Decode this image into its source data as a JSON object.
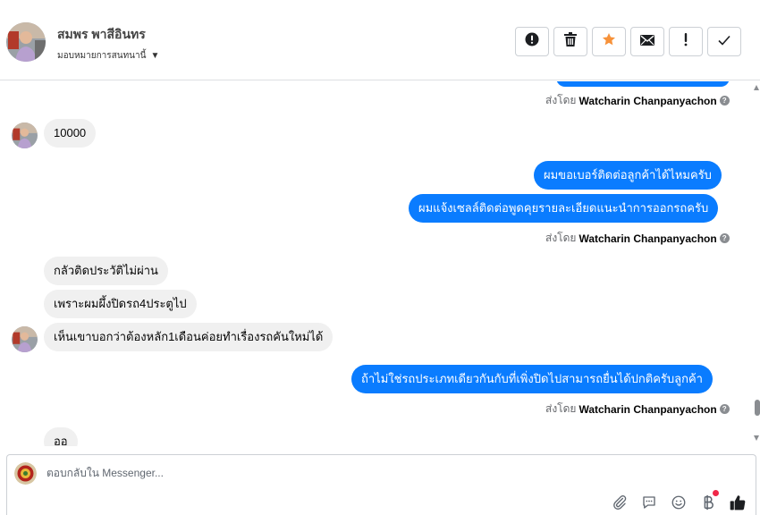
{
  "header": {
    "contact_name": "สมพร พาสีอินทร",
    "assign_label": "มอบหมายการสนทนานี้",
    "actions": [
      {
        "name": "spam-button",
        "icon": "exclamation-circle-icon"
      },
      {
        "name": "delete-button",
        "icon": "trash-icon"
      },
      {
        "name": "star-button",
        "icon": "star-icon"
      },
      {
        "name": "mark-unread-button",
        "icon": "envelope-icon"
      },
      {
        "name": "follow-up-button",
        "icon": "exclamation-icon"
      },
      {
        "name": "mark-done-button",
        "icon": "check-icon"
      }
    ],
    "star_color": "#f7923a"
  },
  "thread": {
    "sent_by_prefix": "ส่งโดย",
    "agent_name": "Watcharin Chanpanyachon",
    "msg_in_1": "10000",
    "msg_out_1": "ผมขอเบอร์ติดต่อลูกค้าได้ไหมครับ",
    "msg_out_2": "ผมแจ้งเซลล์ติดต่อพูดคุยรายละเอียดแนะนำการออกรถครับ",
    "msg_in_2": "กลัวติดประวัติไม่ผ่าน",
    "msg_in_3": "เพราะผมผึ้งปิดรถ4ประตูไป",
    "msg_in_4": "เห็นเขาบอกว่าต้องหลัก1เดือนค่อยทำเรื่องรถคันใหม่ได้",
    "msg_out_3": "ถ้าไม่ใช่รถประเภทเดียวกันกับที่เพิ่งปิดไปสามารถยื่นได้ปกติครับลูกค้า",
    "msg_in_5": "ออ"
  },
  "composer": {
    "placeholder": "ตอบกลับใน Messenger...",
    "tools": [
      "paperclip-icon",
      "saved-replies-icon",
      "emoji-icon",
      "baht-payment-icon",
      "thumbs-up-icon"
    ]
  },
  "colors": {
    "outgoing_bubble": "#0a7cff",
    "incoming_bubble": "#f0f0f0",
    "notification_dot": "#f02849"
  }
}
